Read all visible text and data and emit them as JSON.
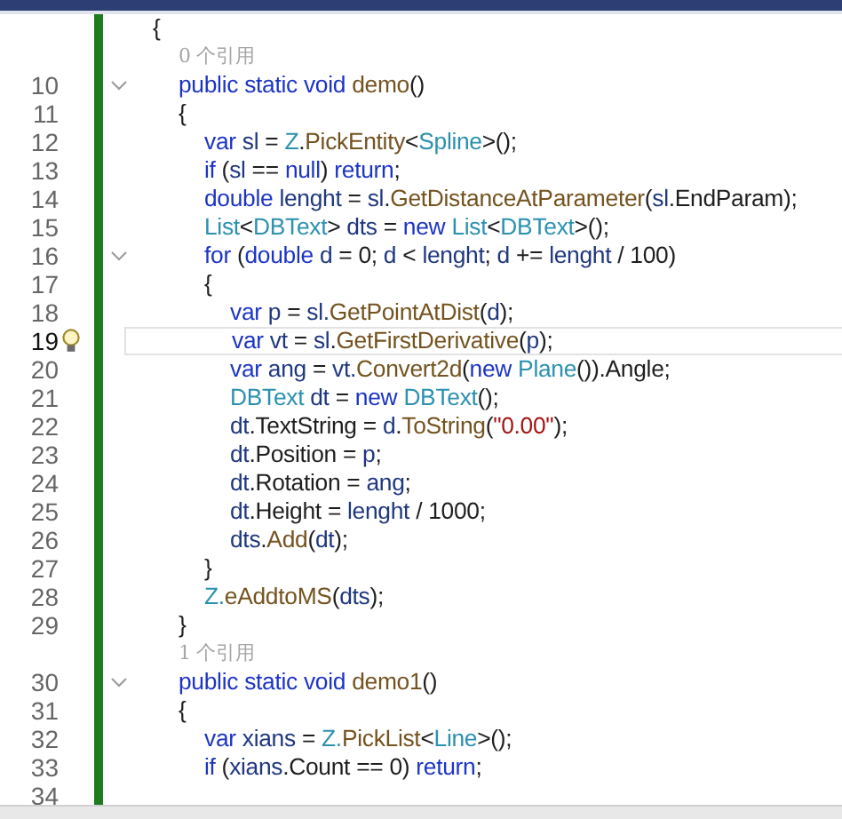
{
  "editor": {
    "lines": [
      {
        "kind": "code",
        "fold": false,
        "current": false,
        "bulb": false,
        "tokens": [
          {
            "text": "{",
            "color": "#1e1e1e"
          }
        ],
        "children": [
          {
            "kind": "hint",
            "text": "0 个引用"
          },
          {
            "kind": "code",
            "number": "10",
            "fold": true,
            "current": false,
            "bulb": false,
            "tokens": [
              {
                "text": "public static void ",
                "color": "#1c34c4"
              },
              {
                "text": "demo",
                "color": "#74531f"
              },
              {
                "text": "()",
                "color": "#1e1e1e"
              }
            ]
          },
          {
            "kind": "code",
            "number": "11",
            "fold": false,
            "current": false,
            "bulb": false,
            "tokens": [
              {
                "text": "{",
                "color": "#1e1e1e"
              }
            ],
            "children": [
              {
                "kind": "code",
                "number": "12",
                "fold": false,
                "current": false,
                "bulb": false,
                "tokens": [
                  {
                    "text": "var ",
                    "color": "#1c34c4"
                  },
                  {
                    "text": "sl",
                    "color": "#1f377f"
                  },
                  {
                    "text": " = ",
                    "color": "#1e1e1e"
                  },
                  {
                    "text": "Z",
                    "color": "#2b91af"
                  },
                  {
                    "text": ".",
                    "color": "#1e1e1e"
                  },
                  {
                    "text": "PickEntity",
                    "color": "#74531f"
                  },
                  {
                    "text": "<",
                    "color": "#1e1e1e"
                  },
                  {
                    "text": "Spline",
                    "color": "#2b91af"
                  },
                  {
                    "text": ">();",
                    "color": "#1e1e1e"
                  }
                ]
              },
              {
                "kind": "code",
                "number": "13",
                "fold": false,
                "current": false,
                "bulb": false,
                "tokens": [
                  {
                    "text": "if",
                    "color": "#1c34c4"
                  },
                  {
                    "text": " (",
                    "color": "#1e1e1e"
                  },
                  {
                    "text": "sl",
                    "color": "#1f377f"
                  },
                  {
                    "text": " == ",
                    "color": "#1e1e1e"
                  },
                  {
                    "text": "null",
                    "color": "#1c34c4"
                  },
                  {
                    "text": ") ",
                    "color": "#1e1e1e"
                  },
                  {
                    "text": "return",
                    "color": "#1c34c4"
                  },
                  {
                    "text": ";",
                    "color": "#1e1e1e"
                  }
                ]
              },
              {
                "kind": "code",
                "number": "14",
                "fold": false,
                "current": false,
                "bulb": false,
                "tokens": [
                  {
                    "text": "double ",
                    "color": "#1c34c4"
                  },
                  {
                    "text": "lenght",
                    "color": "#1f377f"
                  },
                  {
                    "text": " = ",
                    "color": "#1e1e1e"
                  },
                  {
                    "text": "sl",
                    "color": "#1f377f"
                  },
                  {
                    "text": ".",
                    "color": "#1e1e1e"
                  },
                  {
                    "text": "GetDistanceAtParameter",
                    "color": "#74531f"
                  },
                  {
                    "text": "(",
                    "color": "#1e1e1e"
                  },
                  {
                    "text": "sl",
                    "color": "#1f377f"
                  },
                  {
                    "text": ".EndParam);",
                    "color": "#1e1e1e"
                  }
                ]
              },
              {
                "kind": "code",
                "number": "15",
                "fold": false,
                "current": false,
                "bulb": false,
                "tokens": [
                  {
                    "text": "List",
                    "color": "#2b91af"
                  },
                  {
                    "text": "<",
                    "color": "#1e1e1e"
                  },
                  {
                    "text": "DBText",
                    "color": "#2b91af"
                  },
                  {
                    "text": "> ",
                    "color": "#1e1e1e"
                  },
                  {
                    "text": "dts",
                    "color": "#1f377f"
                  },
                  {
                    "text": " = ",
                    "color": "#1e1e1e"
                  },
                  {
                    "text": "new ",
                    "color": "#1c34c4"
                  },
                  {
                    "text": "List",
                    "color": "#2b91af"
                  },
                  {
                    "text": "<",
                    "color": "#1e1e1e"
                  },
                  {
                    "text": "DBText",
                    "color": "#2b91af"
                  },
                  {
                    "text": ">();",
                    "color": "#1e1e1e"
                  }
                ]
              },
              {
                "kind": "code",
                "number": "16",
                "fold": true,
                "current": false,
                "bulb": false,
                "tokens": [
                  {
                    "text": "for",
                    "color": "#1c34c4"
                  },
                  {
                    "text": " (",
                    "color": "#1e1e1e"
                  },
                  {
                    "text": "double ",
                    "color": "#1c34c4"
                  },
                  {
                    "text": "d",
                    "color": "#1f377f"
                  },
                  {
                    "text": " = 0; ",
                    "color": "#1e1e1e"
                  },
                  {
                    "text": "d",
                    "color": "#1f377f"
                  },
                  {
                    "text": " < ",
                    "color": "#1e1e1e"
                  },
                  {
                    "text": "lenght",
                    "color": "#1f377f"
                  },
                  {
                    "text": "; ",
                    "color": "#1e1e1e"
                  },
                  {
                    "text": "d",
                    "color": "#1f377f"
                  },
                  {
                    "text": " += ",
                    "color": "#1e1e1e"
                  },
                  {
                    "text": "lenght",
                    "color": "#1f377f"
                  },
                  {
                    "text": " / 100)",
                    "color": "#1e1e1e"
                  }
                ]
              },
              {
                "kind": "code",
                "number": "17",
                "fold": false,
                "current": false,
                "bulb": false,
                "tokens": [
                  {
                    "text": "{",
                    "color": "#1e1e1e"
                  }
                ],
                "children": [
                  {
                    "kind": "code",
                    "number": "18",
                    "fold": false,
                    "current": false,
                    "bulb": false,
                    "tokens": [
                      {
                        "text": "var ",
                        "color": "#1c34c4"
                      },
                      {
                        "text": "p",
                        "color": "#1f377f"
                      },
                      {
                        "text": " = ",
                        "color": "#1e1e1e"
                      },
                      {
                        "text": "sl.",
                        "color": "#1f377f"
                      },
                      {
                        "text": "GetPointAtDist",
                        "color": "#74531f"
                      },
                      {
                        "text": "(",
                        "color": "#1e1e1e"
                      },
                      {
                        "text": "d",
                        "color": "#1f377f"
                      },
                      {
                        "text": ");",
                        "color": "#1e1e1e"
                      }
                    ]
                  },
                  {
                    "kind": "code",
                    "number": "19",
                    "fold": false,
                    "current": true,
                    "bulb": true,
                    "tokens": [
                      {
                        "text": "var ",
                        "color": "#1c34c4"
                      },
                      {
                        "text": "vt",
                        "color": "#1f377f"
                      },
                      {
                        "text": " = ",
                        "color": "#1e1e1e"
                      },
                      {
                        "text": "sl",
                        "color": "#1f377f"
                      },
                      {
                        "text": ".",
                        "color": "#1e1e1e"
                      },
                      {
                        "text": "GetFirstDerivative",
                        "color": "#74531f"
                      },
                      {
                        "text": "(",
                        "color": "#1e1e1e"
                      },
                      {
                        "text": "p",
                        "color": "#1f377f"
                      },
                      {
                        "text": ");",
                        "color": "#1e1e1e"
                      }
                    ]
                  },
                  {
                    "kind": "code",
                    "number": "20",
                    "fold": false,
                    "current": false,
                    "bulb": false,
                    "tokens": [
                      {
                        "text": "var ",
                        "color": "#1c34c4"
                      },
                      {
                        "text": "ang",
                        "color": "#1f377f"
                      },
                      {
                        "text": " = ",
                        "color": "#1e1e1e"
                      },
                      {
                        "text": "vt.",
                        "color": "#1f377f"
                      },
                      {
                        "text": "Convert2d",
                        "color": "#74531f"
                      },
                      {
                        "text": "(",
                        "color": "#1e1e1e"
                      },
                      {
                        "text": "new ",
                        "color": "#1c34c4"
                      },
                      {
                        "text": "Plane",
                        "color": "#2b91af"
                      },
                      {
                        "text": "()).Angle;",
                        "color": "#1e1e1e"
                      }
                    ]
                  },
                  {
                    "kind": "code",
                    "number": "21",
                    "fold": false,
                    "current": false,
                    "bulb": false,
                    "tokens": [
                      {
                        "text": "DBText ",
                        "color": "#2b91af"
                      },
                      {
                        "text": "dt",
                        "color": "#1f377f"
                      },
                      {
                        "text": " = ",
                        "color": "#1e1e1e"
                      },
                      {
                        "text": "new ",
                        "color": "#1c34c4"
                      },
                      {
                        "text": "DBText",
                        "color": "#2b91af"
                      },
                      {
                        "text": "();",
                        "color": "#1e1e1e"
                      }
                    ]
                  },
                  {
                    "kind": "code",
                    "number": "22",
                    "fold": false,
                    "current": false,
                    "bulb": false,
                    "tokens": [
                      {
                        "text": "dt",
                        "color": "#1f377f"
                      },
                      {
                        "text": ".TextString = ",
                        "color": "#1e1e1e"
                      },
                      {
                        "text": "d",
                        "color": "#1f377f"
                      },
                      {
                        "text": ".",
                        "color": "#1e1e1e"
                      },
                      {
                        "text": "ToString",
                        "color": "#74531f"
                      },
                      {
                        "text": "(",
                        "color": "#1e1e1e"
                      },
                      {
                        "text": "\"0.00\"",
                        "color": "#a31515"
                      },
                      {
                        "text": ");",
                        "color": "#1e1e1e"
                      }
                    ]
                  },
                  {
                    "kind": "code",
                    "number": "23",
                    "fold": false,
                    "current": false,
                    "bulb": false,
                    "tokens": [
                      {
                        "text": "dt",
                        "color": "#1f377f"
                      },
                      {
                        "text": ".Position = ",
                        "color": "#1e1e1e"
                      },
                      {
                        "text": "p",
                        "color": "#1f377f"
                      },
                      {
                        "text": ";",
                        "color": "#1e1e1e"
                      }
                    ]
                  },
                  {
                    "kind": "code",
                    "number": "24",
                    "fold": false,
                    "current": false,
                    "bulb": false,
                    "tokens": [
                      {
                        "text": "dt",
                        "color": "#1f377f"
                      },
                      {
                        "text": ".Rotation = ",
                        "color": "#1e1e1e"
                      },
                      {
                        "text": "ang",
                        "color": "#1f377f"
                      },
                      {
                        "text": ";",
                        "color": "#1e1e1e"
                      }
                    ]
                  },
                  {
                    "kind": "code",
                    "number": "25",
                    "fold": false,
                    "current": false,
                    "bulb": false,
                    "tokens": [
                      {
                        "text": "dt",
                        "color": "#1f377f"
                      },
                      {
                        "text": ".Height = ",
                        "color": "#1e1e1e"
                      },
                      {
                        "text": "lenght",
                        "color": "#1f377f"
                      },
                      {
                        "text": " / 1000;",
                        "color": "#1e1e1e"
                      }
                    ]
                  },
                  {
                    "kind": "code",
                    "number": "26",
                    "fold": false,
                    "current": false,
                    "bulb": false,
                    "tokens": [
                      {
                        "text": "dts",
                        "color": "#1f377f"
                      },
                      {
                        "text": ".",
                        "color": "#1e1e1e"
                      },
                      {
                        "text": "Add",
                        "color": "#74531f"
                      },
                      {
                        "text": "(",
                        "color": "#1e1e1e"
                      },
                      {
                        "text": "dt",
                        "color": "#1f377f"
                      },
                      {
                        "text": ");",
                        "color": "#1e1e1e"
                      }
                    ]
                  }
                ]
              },
              {
                "kind": "code",
                "number": "27",
                "fold": false,
                "current": false,
                "bulb": false,
                "tokens": [
                  {
                    "text": "}",
                    "color": "#1e1e1e"
                  }
                ]
              },
              {
                "kind": "code",
                "number": "28",
                "fold": false,
                "current": false,
                "bulb": false,
                "tokens": [
                  {
                    "text": "Z.",
                    "color": "#2b91af"
                  },
                  {
                    "text": "eAddtoMS",
                    "color": "#74531f"
                  },
                  {
                    "text": "(",
                    "color": "#1e1e1e"
                  },
                  {
                    "text": "dts",
                    "color": "#1f377f"
                  },
                  {
                    "text": ");",
                    "color": "#1e1e1e"
                  }
                ]
              }
            ]
          },
          {
            "kind": "code",
            "number": "29",
            "fold": false,
            "current": false,
            "bulb": false,
            "tokens": [
              {
                "text": "}",
                "color": "#1e1e1e"
              }
            ]
          },
          {
            "kind": "hint",
            "text": "1 个引用"
          },
          {
            "kind": "code",
            "number": "30",
            "fold": true,
            "current": false,
            "bulb": false,
            "tokens": [
              {
                "text": "public static void ",
                "color": "#1c34c4"
              },
              {
                "text": "demo1",
                "color": "#74531f"
              },
              {
                "text": "()",
                "color": "#1e1e1e"
              }
            ]
          },
          {
            "kind": "code",
            "number": "31",
            "fold": false,
            "current": false,
            "bulb": false,
            "tokens": [
              {
                "text": "{",
                "color": "#1e1e1e"
              }
            ],
            "children": [
              {
                "kind": "code",
                "number": "32",
                "fold": false,
                "current": false,
                "bulb": false,
                "tokens": [
                  {
                    "text": "var ",
                    "color": "#1c34c4"
                  },
                  {
                    "text": "xians",
                    "color": "#1f377f"
                  },
                  {
                    "text": " = ",
                    "color": "#1e1e1e"
                  },
                  {
                    "text": "Z.",
                    "color": "#2b91af"
                  },
                  {
                    "text": "PickList",
                    "color": "#74531f"
                  },
                  {
                    "text": "<",
                    "color": "#1e1e1e"
                  },
                  {
                    "text": "Line",
                    "color": "#2b91af"
                  },
                  {
                    "text": ">();",
                    "color": "#1e1e1e"
                  }
                ]
              },
              {
                "kind": "code",
                "number": "33",
                "fold": false,
                "current": false,
                "bulb": false,
                "tokens": [
                  {
                    "text": "if",
                    "color": "#1c34c4"
                  },
                  {
                    "text": " (",
                    "color": "#1e1e1e"
                  },
                  {
                    "text": "xians",
                    "color": "#1f377f"
                  },
                  {
                    "text": ".Count == 0) ",
                    "color": "#1e1e1e"
                  },
                  {
                    "text": "return",
                    "color": "#1c34c4"
                  },
                  {
                    "text": ";",
                    "color": "#1e1e1e"
                  }
                ]
              },
              {
                "kind": "code",
                "number": "34",
                "fold": false,
                "current": false,
                "bulb": false
              }
            ]
          }
        ]
      }
    ]
  }
}
